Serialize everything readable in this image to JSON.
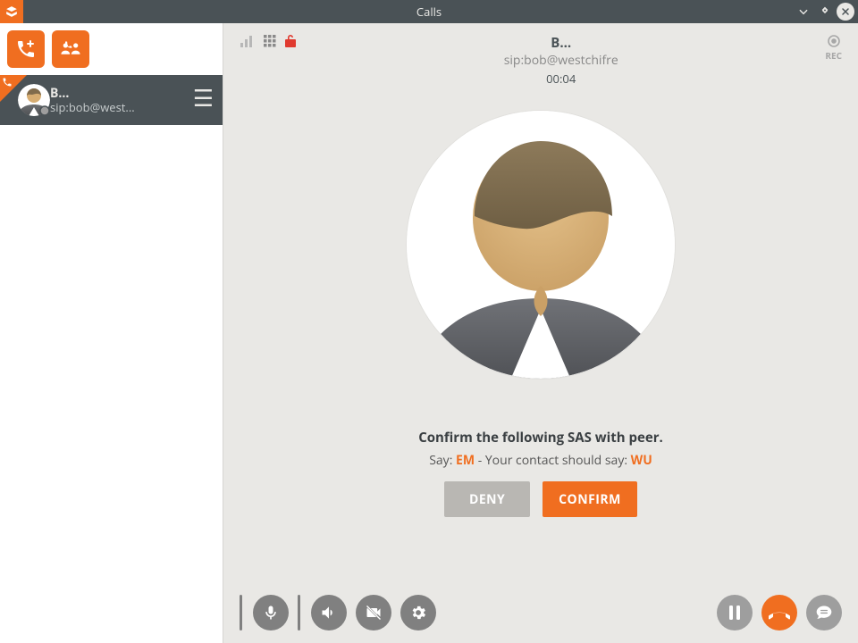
{
  "window": {
    "title": "Calls"
  },
  "sidebar": {
    "call_row": {
      "name": "B...",
      "uri": "sip:bob@west..."
    }
  },
  "call": {
    "display_name": "B...",
    "uri": "sip:bob@westchifre",
    "duration": "00:04",
    "rec_label": "REC"
  },
  "sas": {
    "instruction": "Confirm the following SAS with peer.",
    "say_label": "Say:",
    "say_value": "EM",
    "separator": " - ",
    "peer_label": "Your contact should say:",
    "peer_value": "WU",
    "deny_label": "DENY",
    "confirm_label": "CONFIRM"
  }
}
